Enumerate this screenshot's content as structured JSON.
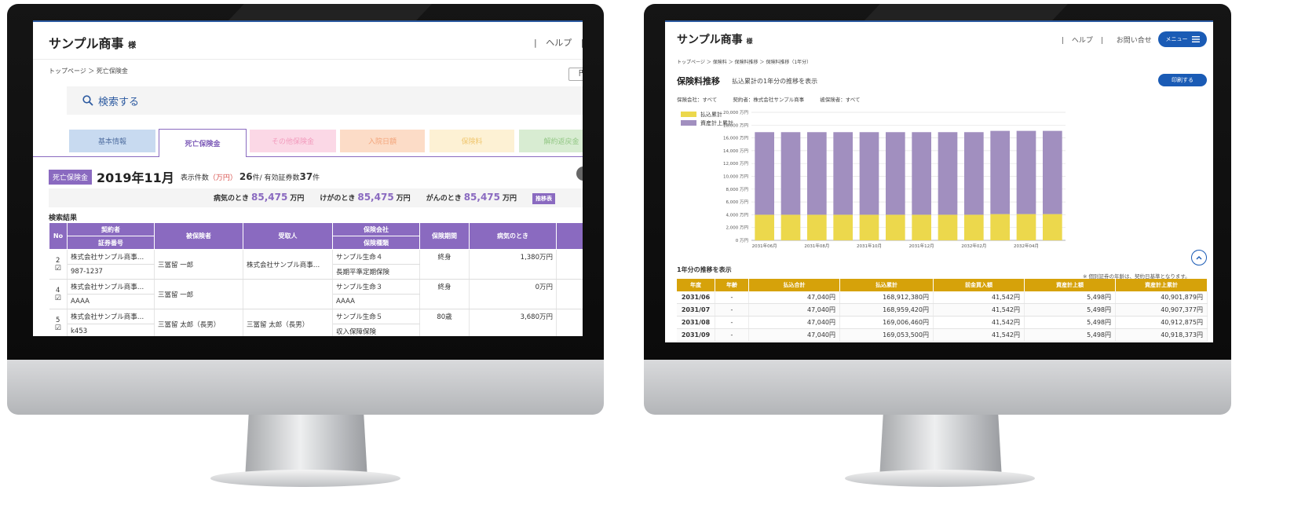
{
  "left": {
    "company": "サンプル商事",
    "company_suffix": "様",
    "header_sep1": "|",
    "header_help": "ヘルプ",
    "header_sep2": "|",
    "breadcrumb": "トップページ ＞ 死亡保険金",
    "unit_button": "円",
    "search_label": "検索する",
    "tabs": [
      {
        "label": "基本情報",
        "bg": "#c8daf0",
        "color": "#5573a3"
      },
      {
        "label": "死亡保険金",
        "bg": "#ffffff",
        "color": "#7e5cb8"
      },
      {
        "label": "その他保険金",
        "bg": "#fbd8e6",
        "color": "#f29bbd"
      },
      {
        "label": "入院日額",
        "bg": "#fcdcc7",
        "color": "#f3a47a"
      },
      {
        "label": "保険料",
        "bg": "#fdf1d4",
        "color": "#f0c770"
      },
      {
        "label": "解約返戻金",
        "bg": "#d8ecd2",
        "color": "#92c784"
      }
    ],
    "badge": "死亡保険金",
    "period": "2019年11月",
    "count_label": "表示件数",
    "unit_paren": "（万円）",
    "count_value": "26",
    "count_suffix": "件/ 有効証券数",
    "valid_count": "37",
    "valid_suffix": "件",
    "summary": [
      {
        "label": "病気のとき",
        "value": "85,475",
        "unit": "万円"
      },
      {
        "label": "けがのとき",
        "value": "85,475",
        "unit": "万円"
      },
      {
        "label": "がんのとき",
        "value": "85,475",
        "unit": "万円"
      }
    ],
    "trend_button": "推移表",
    "results_title": "検索結果",
    "columns": {
      "no": "No",
      "contractor": "契約者",
      "policy_no": "証券番号",
      "insured": "被保険者",
      "recipient": "受取人",
      "insurer": "保険会社",
      "type": "保険種類",
      "term": "保険期間",
      "sick": "病気のとき"
    },
    "rows": [
      {
        "no": "2",
        "contractor": "株式会社サンプル商事…",
        "policy": "987-1237",
        "insured": "三冨留 一郎",
        "recipient": "株式会社サンプル商事…",
        "insurer": "サンプル生命４",
        "type": "長期平準定期保険",
        "term": "終身",
        "sick": "1,380万円"
      },
      {
        "no": "4",
        "contractor": "株式会社サンプル商事…",
        "policy": "AAAA",
        "insured": "三冨留 一郎",
        "recipient": "",
        "insurer": "サンプル生命３",
        "type": "AAAA",
        "term": "終身",
        "sick": "0万円"
      },
      {
        "no": "5",
        "contractor": "株式会社サンプル商事…",
        "policy": "k453",
        "insured": "三冨留 太郎（長男）",
        "recipient": "三冨留 太郎（長男）",
        "insurer": "サンプル生命５",
        "type": "収入保障保険",
        "term": "80歳",
        "sick": "3,680万円"
      }
    ]
  },
  "right": {
    "company": "サンプル商事",
    "company_suffix": "様",
    "header_sep1": "|",
    "header_help": "ヘルプ",
    "header_sep2": "|",
    "header_contact": "お問い合せ",
    "menu_label": "メニュー",
    "breadcrumb": "トップページ ＞ 保険料 ＞ 保険料推移 ＞ 保険料推移（1年分）",
    "page_title": "保険料推移",
    "page_subtitle": "払込累計の1年分の推移を表示",
    "print_button": "印刷する",
    "filters": [
      "保険会社：すべて",
      "契約者：株式会社サンプル商事",
      "被保険者：すべて"
    ],
    "section_title": "1年分の推移を表示",
    "note": "※ 個別証券の年齢は、契約日基準となります。",
    "table_headers": [
      "年度",
      "年齢",
      "払込合計",
      "払込累計",
      "前金買入額",
      "資産計上額",
      "資産計上累計"
    ],
    "table_rows": [
      [
        "2031/06",
        "-",
        "47,040円",
        "168,912,380円",
        "41,542円",
        "5,498円",
        "40,901,879円"
      ],
      [
        "2031/07",
        "-",
        "47,040円",
        "168,959,420円",
        "41,542円",
        "5,498円",
        "40,907,377円"
      ],
      [
        "2031/08",
        "-",
        "47,040円",
        "169,006,460円",
        "41,542円",
        "5,498円",
        "40,912,875円"
      ],
      [
        "2031/09",
        "-",
        "47,040円",
        "169,053,500円",
        "41,542円",
        "5,498円",
        "40,918,373円"
      ]
    ]
  },
  "chart_data": {
    "type": "bar",
    "stacked": true,
    "categories": [
      "2031年06月",
      "",
      "2031年08月",
      "",
      "2031年10月",
      "",
      "2031年12月",
      "",
      "2032年02月",
      "",
      "2032年04月",
      ""
    ],
    "series": [
      {
        "name": "払込累計",
        "color": "#ecd84c",
        "values": [
          4000,
          4000,
          4000,
          4000,
          4000,
          4000,
          4000,
          4000,
          4000,
          4100,
          4100,
          4100
        ]
      },
      {
        "name": "資産計上累計",
        "color": "#a18fbf",
        "values": [
          12900,
          12900,
          12900,
          12900,
          12900,
          12900,
          12900,
          12900,
          12900,
          13000,
          13000,
          13000
        ]
      }
    ],
    "yticks": [
      "0 万円",
      "2,000 万円",
      "4,000 万円",
      "6,000 万円",
      "8,000 万円",
      "10,000 万円",
      "12,000 万円",
      "14,000 万円",
      "16,000 万円",
      "18,000 万円",
      "20,000 万円"
    ],
    "ylim": [
      0,
      20000
    ],
    "grid": true,
    "legend": "top-left"
  }
}
